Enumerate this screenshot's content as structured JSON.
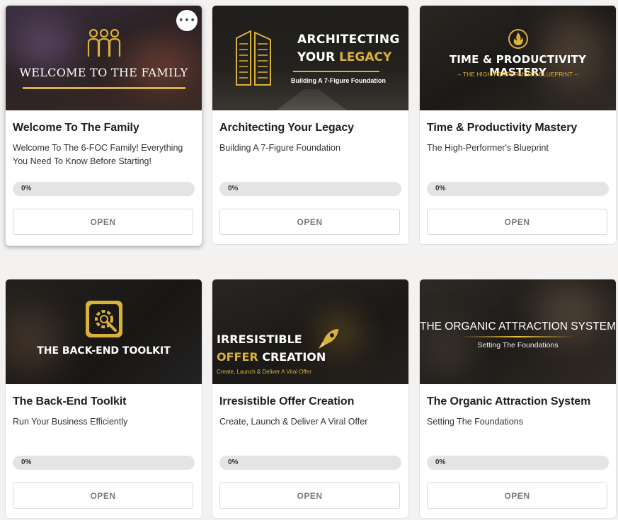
{
  "colors": {
    "accent_gold": "#d9b13b",
    "button_text": "#7a7a7a",
    "page_bg": "#f3f2f0"
  },
  "courses": [
    {
      "title": "Welcome To The Family",
      "description": "Welcome To The 6-FOC Family! Everything You Need To Know Before Starting!",
      "progress_percent": 0,
      "progress_label": "0%",
      "button_label": "OPEN",
      "thumbnail": {
        "heading": "WELCOME TO THE FAMILY",
        "icon": "family-icon"
      },
      "menu_label": "•••"
    },
    {
      "title": "Architecting Your Legacy",
      "description": "Building A 7-Figure Foundation",
      "progress_percent": 0,
      "progress_label": "0%",
      "button_label": "OPEN",
      "thumbnail": {
        "heading_line1": "ARCHITECTING",
        "heading_line2a": "YOUR ",
        "heading_line2b": "LEGACY",
        "subheading": "Building A 7-Figure Foundation",
        "icon": "skyscraper-icon"
      }
    },
    {
      "title": "Time & Productivity Mastery",
      "description": "The High-Performer's Blueprint",
      "progress_percent": 0,
      "progress_label": "0%",
      "button_label": "OPEN",
      "thumbnail": {
        "heading": "TIME & PRODUCTIVITY MASTERY",
        "subheading": "-- THE HIGH-PERFORMER'S BLUEPRINT --",
        "icon": "flame-icon"
      }
    },
    {
      "title": "The Back-End Toolkit",
      "description": "Run Your Business Efficiently",
      "progress_percent": 0,
      "progress_label": "0%",
      "button_label": "OPEN",
      "thumbnail": {
        "heading": "THE BACK-END TOOLKIT",
        "icon": "gear-wrench-icon"
      }
    },
    {
      "title": "Irresistible Offer Creation",
      "description": "Create, Launch & Deliver A Viral Offer",
      "progress_percent": 0,
      "progress_label": "0%",
      "button_label": "OPEN",
      "thumbnail": {
        "heading_line1": "IRRESISTIBLE",
        "heading_line2a": "OFFER ",
        "heading_line2b": "CREATION",
        "subheading": "Create, Launch & Deliver A Viral Offer",
        "icon": "rocket-icon"
      }
    },
    {
      "title": "The Organic Attraction System",
      "description": "Setting The Foundations",
      "progress_percent": 0,
      "progress_label": "0%",
      "button_label": "OPEN",
      "thumbnail": {
        "heading": "THE ORGANIC ATTRACTION SYSTEM",
        "subheading": "Setting The Foundations"
      }
    }
  ]
}
